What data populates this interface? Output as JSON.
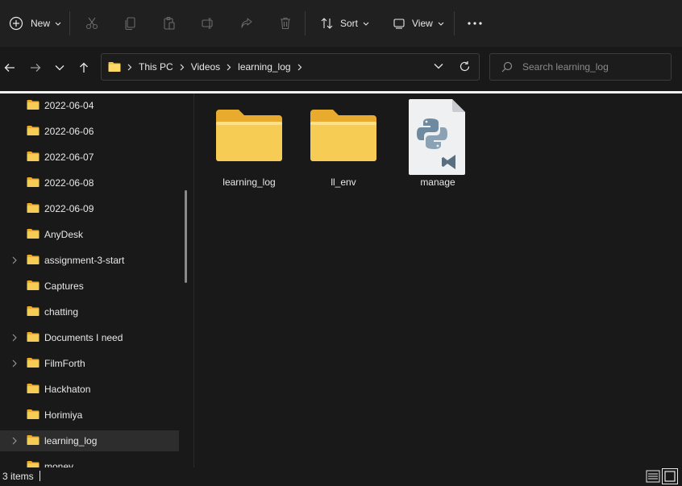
{
  "toolbar": {
    "new_label": "New",
    "sort_label": "Sort",
    "view_label": "View"
  },
  "address": {
    "crumbs": [
      "This PC",
      "Videos",
      "learning_log"
    ]
  },
  "search": {
    "placeholder": "Search learning_log"
  },
  "sidebar": {
    "items": [
      {
        "label": "2022-06-04",
        "expandable": false,
        "selected": false
      },
      {
        "label": "2022-06-06",
        "expandable": false,
        "selected": false
      },
      {
        "label": "2022-06-07",
        "expandable": false,
        "selected": false
      },
      {
        "label": "2022-06-08",
        "expandable": false,
        "selected": false
      },
      {
        "label": "2022-06-09",
        "expandable": false,
        "selected": false
      },
      {
        "label": "AnyDesk",
        "expandable": false,
        "selected": false
      },
      {
        "label": "assignment-3-start",
        "expandable": true,
        "selected": false
      },
      {
        "label": "Captures",
        "expandable": false,
        "selected": false
      },
      {
        "label": "chatting",
        "expandable": false,
        "selected": false
      },
      {
        "label": "Documents I need",
        "expandable": true,
        "selected": false
      },
      {
        "label": "FilmForth",
        "expandable": true,
        "selected": false
      },
      {
        "label": "Hackhaton",
        "expandable": false,
        "selected": false
      },
      {
        "label": "Horimiya",
        "expandable": false,
        "selected": false
      },
      {
        "label": "learning_log",
        "expandable": true,
        "selected": true
      },
      {
        "label": "money",
        "expandable": false,
        "selected": false
      }
    ]
  },
  "files": [
    {
      "name": "learning_log",
      "kind": "folder-icon"
    },
    {
      "name": "ll_env",
      "kind": "folder-icon"
    },
    {
      "name": "manage",
      "kind": "python-file-icon"
    }
  ],
  "status": {
    "count": "3 items"
  },
  "colors": {
    "folder": "#f4c542",
    "folder_light": "#ffd866",
    "background": "#191919",
    "toolbar": "#202020"
  }
}
